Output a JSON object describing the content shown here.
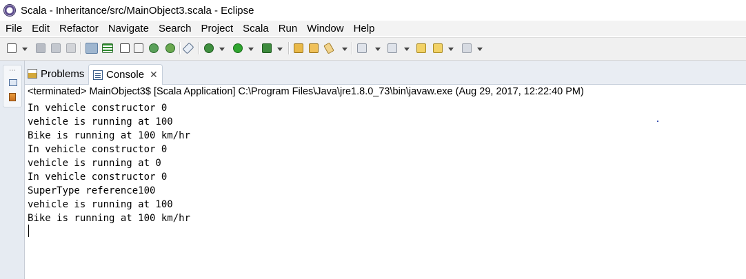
{
  "window": {
    "title": "Scala - Inheritance/src/MainObject3.scala - Eclipse"
  },
  "menu": [
    "File",
    "Edit",
    "Refactor",
    "Navigate",
    "Search",
    "Project",
    "Scala",
    "Run",
    "Window",
    "Help"
  ],
  "tabs": {
    "problems": "Problems",
    "console": "Console"
  },
  "console": {
    "status": "<terminated> MainObject3$ [Scala Application] C:\\Program Files\\Java\\jre1.8.0_73\\bin\\javaw.exe (Aug 29, 2017, 12:22:40 PM)",
    "lines": [
      "In vehicle constructor 0",
      "vehicle is running at 100",
      "Bike is running at 100 km/hr",
      "In vehicle constructor 0",
      "vehicle is running at 0",
      "In vehicle constructor 0",
      "SuperType reference100",
      "vehicle is running at 100",
      "Bike is running at 100 km/hr"
    ]
  },
  "toolbar_icons": [
    "new-icon",
    "save-icon",
    "save-all-icon",
    "print-icon",
    "toggle-breadcrumb-icon",
    "mark-occurrences-icon",
    "info-icon",
    "tasks-icon",
    "debug-config-icon",
    "debug-icon",
    "skip-breakpoints-icon",
    "run-icon",
    "external-tools-icon",
    "open-type-icon",
    "open-package-icon",
    "search-icon",
    "next-annotation-icon",
    "prev-annotation-icon",
    "last-edit-icon",
    "back-icon",
    "forward-icon"
  ]
}
